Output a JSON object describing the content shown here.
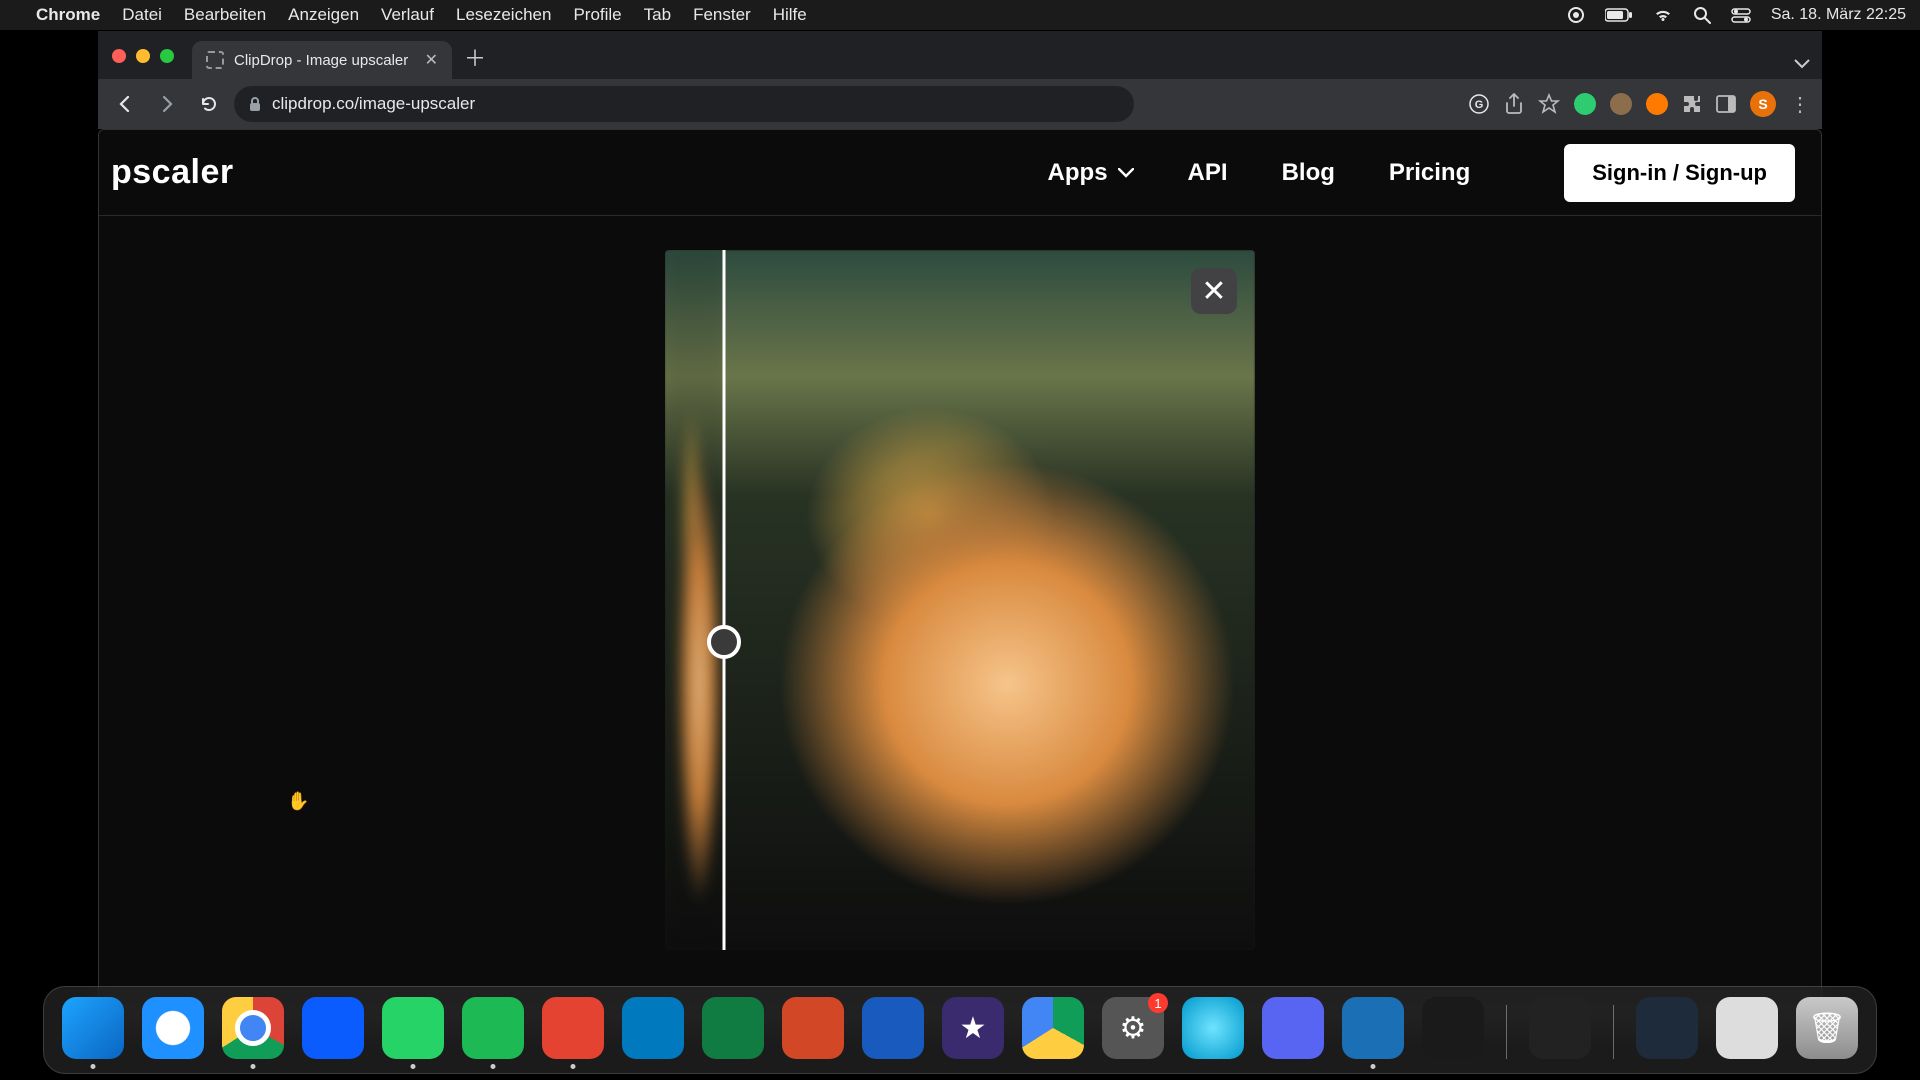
{
  "menubar": {
    "app": "Chrome",
    "items": [
      "Datei",
      "Bearbeiten",
      "Anzeigen",
      "Verlauf",
      "Lesezeichen",
      "Profile",
      "Tab",
      "Fenster",
      "Hilfe"
    ],
    "clock": "Sa. 18. März  22:25"
  },
  "browser": {
    "tab_title": "ClipDrop - Image upscaler",
    "url_display": "clipdrop.co/image-upscaler",
    "avatar_initial": "S"
  },
  "page": {
    "brand_fragment": "pscaler",
    "nav": {
      "apps": "Apps",
      "api": "API",
      "blog": "Blog",
      "pricing": "Pricing"
    },
    "signin": "Sign-in / Sign-up"
  },
  "compare": {
    "slider_position_pct": 10,
    "handle_vertical_pct": 56
  },
  "dock": {
    "settings_badge": "1"
  }
}
